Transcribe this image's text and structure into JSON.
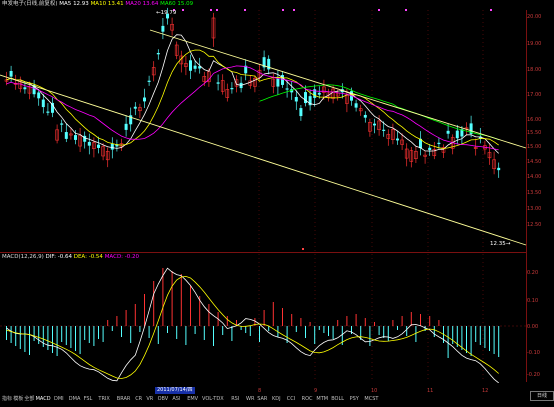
{
  "header": {
    "stock": "申发电子(日线,前复权)",
    "ma5_label": "MA5",
    "ma5_value": "12.93",
    "ma10_label": "MA10",
    "ma10_value": "13.41",
    "ma20_label": "MA20",
    "ma20_value": "13.64",
    "ma60_label": "MA60",
    "ma60_value": "15.09"
  },
  "price_axis": [
    "20.00",
    "19.00",
    "18.00",
    "17.00",
    "16.00",
    "15.50",
    "15.00",
    "14.50",
    "14.00",
    "13.50",
    "13.00",
    "12.50"
  ],
  "macd_header": {
    "name": "MACD(12,26,9)",
    "dif_label": "DIF:",
    "dif_value": "-0.64",
    "dea_label": "DEA:",
    "dea_value": "-0.54",
    "macd_label": "MACD:",
    "macd_value": "-0.20"
  },
  "macd_axis": [
    "0.20",
    "0.10",
    "0.00",
    "-0.10",
    "-0.20"
  ],
  "annotations": {
    "high": "19.79",
    "low": "12.35"
  },
  "date_cursor": "2011/07/14/四",
  "date_ticks": [
    "8",
    "9",
    "10",
    "11",
    "12"
  ],
  "indicator_tabs": [
    "指标",
    "模板",
    "全部",
    "MACD",
    "DMI",
    "DMA",
    "FSL",
    "TRIX",
    "BRAR",
    "CR",
    "VR",
    "OBV",
    "ASI",
    "EMV",
    "VOL-TDX",
    "RSI",
    "WR",
    "SAR",
    "KDJ",
    "CCI",
    "ROC",
    "MTM",
    "BOLL",
    "PSY",
    "MCST"
  ],
  "active_tab": "MACD",
  "right_tab": "日线",
  "colors": {
    "up": "#ff3232",
    "down": "#54ffff",
    "ma5": "#ffffff",
    "ma10": "#ffff00",
    "ma20": "#ff00ff",
    "ma60": "#00ff00",
    "channel": "#ffff99",
    "grid": "#7a1010"
  }
}
